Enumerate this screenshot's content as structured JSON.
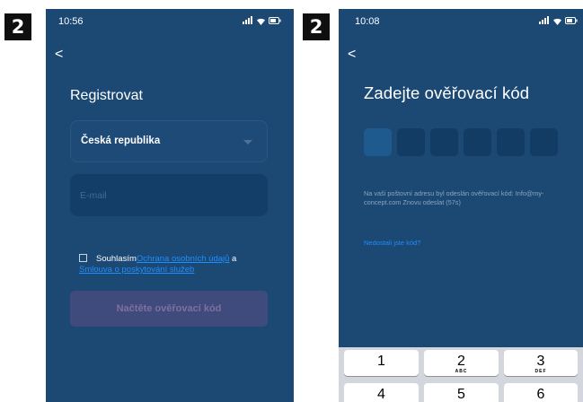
{
  "steps": {
    "left": "2",
    "right": "2"
  },
  "phone1": {
    "time": "10:56",
    "back_glyph": "<",
    "title": "Registrovat",
    "country": "Česká republika",
    "email_placeholder": "E-mail",
    "consent_prefix": "Souhlasím",
    "privacy_link": "Ochrana osobních údajů",
    "consent_and": " a",
    "terms_link": "Smlouva o poskytování služeb",
    "load_button": "Načtěte ověřovací kód"
  },
  "phone2": {
    "time": "10:08",
    "back_glyph": "<",
    "title": "Zadejte ověřovací kód",
    "code_digits": 6,
    "info_text": "Na vaši poštovní adresu byl odeslán ověřovací kód: Info@my-concept.com  Znovu odeslat (57s)",
    "resend_link": "Nedostali jste kód?",
    "keypad": [
      {
        "num": "1",
        "letters": ""
      },
      {
        "num": "2",
        "letters": "ABC"
      },
      {
        "num": "3",
        "letters": "DEF"
      },
      {
        "num": "4",
        "letters": ""
      },
      {
        "num": "5",
        "letters": ""
      },
      {
        "num": "6",
        "letters": ""
      }
    ]
  },
  "colors": {
    "screen_bg": "#1c4874",
    "link": "#1e8fff",
    "button_disabled": "#3e4b7c"
  },
  "icons": [
    "signal-icon",
    "wifi-icon",
    "battery-icon",
    "back-chevron-icon",
    "dropdown-caret-icon",
    "checkbox-icon"
  ]
}
